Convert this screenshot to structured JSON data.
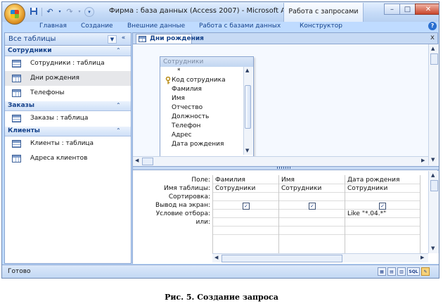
{
  "app": {
    "title": "Фирма : база данных (Access 2007) - Microsoft Acce...",
    "context_tab_title": "Работа с запросами",
    "window_controls": {
      "minimize": "–",
      "maximize": "□",
      "close": "✕"
    }
  },
  "qat": {
    "icons": [
      "save-icon",
      "undo-icon",
      "redo-icon",
      "customize-icon"
    ]
  },
  "ribbon": {
    "tabs": [
      "Главная",
      "Создание",
      "Внешние данные",
      "Работа с базами данных",
      "Конструктор"
    ],
    "help": "?"
  },
  "nav": {
    "title": "Все таблицы",
    "dropdown": "▼",
    "shutter": "«",
    "groups": [
      {
        "label": "Сотрудники",
        "chevron": "⌃",
        "items": [
          {
            "label": "Сотрудники : таблица",
            "icon": "table-icon"
          },
          {
            "label": "Дни рождения",
            "icon": "query-icon",
            "selected": true
          },
          {
            "label": "Телефоны",
            "icon": "query-icon"
          }
        ]
      },
      {
        "label": "Заказы",
        "chevron": "⌃",
        "items": [
          {
            "label": "Заказы : таблица",
            "icon": "table-icon"
          }
        ]
      },
      {
        "label": "Клиенты",
        "chevron": "⌃",
        "items": [
          {
            "label": "Клиенты : таблица",
            "icon": "table-icon"
          },
          {
            "label": "Адреса клиентов",
            "icon": "query-icon"
          }
        ]
      }
    ]
  },
  "document": {
    "tab_label": "Дни рождения",
    "close": "x",
    "field_list": {
      "title": "Сотрудники",
      "fields": [
        "*",
        "Код сотрудника",
        "Фамилия",
        "Имя",
        "Отчество",
        "Должность",
        "Телефон",
        "Адрес",
        "Дата рождения"
      ],
      "key_field": "Код сотрудника"
    },
    "grid": {
      "row_labels": [
        "Поле:",
        "Имя таблицы:",
        "Сортировка:",
        "Вывод на экран:",
        "Условие отбора:",
        "или:"
      ],
      "columns": [
        {
          "field": "Фамилия",
          "table": "Сотрудники",
          "sort": "",
          "show": true,
          "criteria": ""
        },
        {
          "field": "Имя",
          "table": "Сотрудники",
          "sort": "",
          "show": true,
          "criteria": ""
        },
        {
          "field": "Дата рождения",
          "table": "Сотрудники",
          "sort": "",
          "show": true,
          "criteria": "Like \"*.04.*\""
        }
      ]
    }
  },
  "status": {
    "text": "Готово",
    "views": [
      "datasheet-view-icon",
      "pivottable-view-icon",
      "pivotchart-view-icon",
      "SQL",
      "design-view-icon"
    ]
  },
  "caption": "Рис. 5. Создание запроса"
}
